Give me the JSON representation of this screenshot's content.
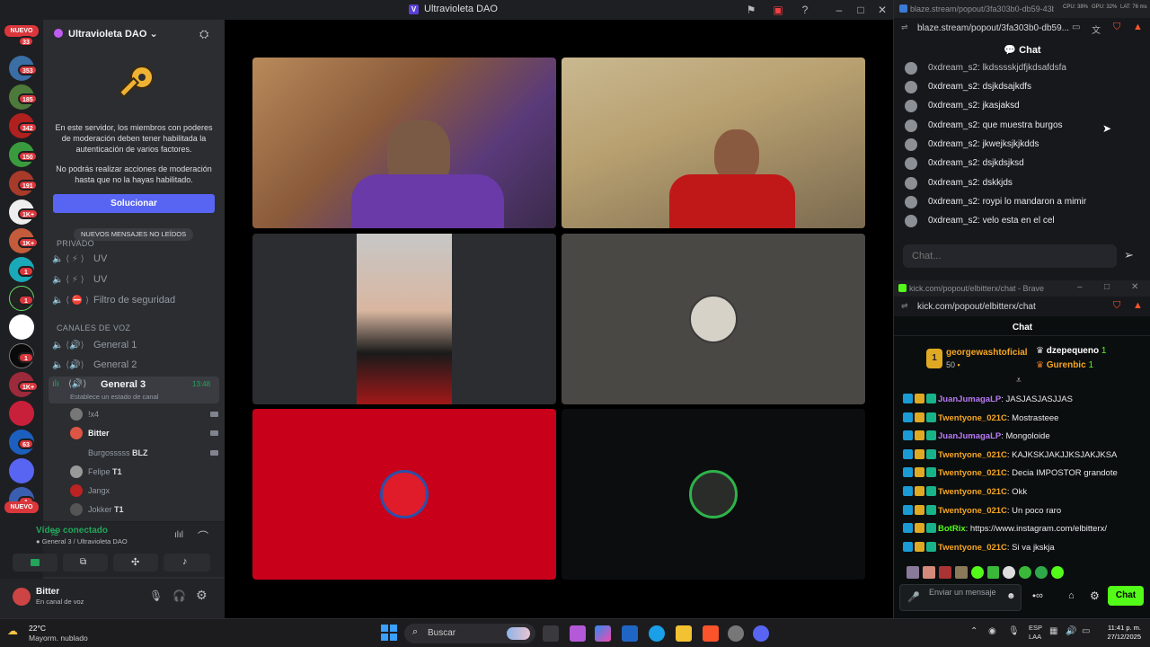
{
  "titlebar": {
    "app_letter": "V",
    "title": "Ultravioleta DAO"
  },
  "servers": {
    "top_badge": "NUEVO",
    "bottom_badge": "NUEVO",
    "badges": [
      "33",
      "353",
      "185",
      "342",
      "150",
      "191",
      "1K+",
      "1K+",
      "1",
      "1",
      "1",
      "1K+",
      "63",
      "1",
      "1"
    ]
  },
  "sidebar": {
    "server_name": "Ultravioleta DAO",
    "chevron": "⌄",
    "mfa_notice_1": "En este servidor, los miembros con poderes de moderación deben tener habilitada la autenticación de varios factores.",
    "mfa_notice_2": "No podrás realizar acciones de moderación hasta que no la hayas habilitado.",
    "solve_button": "Solucionar",
    "new_messages_pill": "NUEVOS MENSAJES NO LEÍDOS",
    "private_category": "PRIVADO",
    "private_channels": [
      "UV",
      "UV",
      "Filtro de seguridad"
    ],
    "voice_category": "CANALES DE VOZ",
    "voice_channels": [
      "General 1",
      "General 2",
      "General 3"
    ],
    "active_time": "13:48",
    "status_hint": "Establece un estado de canal",
    "members": [
      {
        "name": "!x4",
        "tag": ""
      },
      {
        "name": "Bitter",
        "tag": ""
      },
      {
        "name": "Burgosssss",
        "tag": "BLZ"
      },
      {
        "name": "Felipe",
        "tag": "T1"
      },
      {
        "name": "Jangx",
        "tag": ""
      },
      {
        "name": "Jokker",
        "tag": "T1"
      }
    ]
  },
  "voice_panel": {
    "status": "Vídeo conectado",
    "location": "General 3 / Ultravioleta DAO"
  },
  "user_panel": {
    "name": "Bitter",
    "status": "En canal de voz"
  },
  "blaze": {
    "tab_url": "blaze.stream/popout/3fa303b0-db59-43b...",
    "address": "blaze.stream/popout/3fa303b0-db59...",
    "header": "Chat",
    "messages": [
      "0xdream_s2: lkdsssskjdfjkdsafdsfa",
      "0xdream_s2: dsjkdsajkdfs",
      "0xdream_s2: jkasjaksd",
      "0xdream_s2: que muestra burgos",
      "0xdream_s2: jkwejksjkjkdds",
      "0xdream_s2: dsjkdsjksd",
      "0xdream_s2: dskkjds",
      "0xdream_s2: roypi lo mandaron a mimir",
      "0xdream_s2: velo esta en el cel"
    ],
    "input_placeholder": "Chat...",
    "sys_cpu": "CPU: 38%",
    "sys_gpu": "GPU: 32%",
    "sys_lat": "LAT: 76 ms"
  },
  "kick": {
    "tab_url": "kick.com/popout/elbitterx/chat - Brave",
    "address": "kick.com/popout/elbitterx/chat",
    "header": "Chat",
    "gifter_rank": "1",
    "gifter_name": "georgewashtoficial",
    "gifter_amount": "50",
    "top_user_1": "dzepequeno",
    "top_user_1_count": "1",
    "top_user_2": "Gurenbic",
    "top_user_2_count": "1",
    "messages": [
      {
        "user": "JuanJumagaLP",
        "color": "#b97af5",
        "text": ": JASJASJASJJAS"
      },
      {
        "user": "Twentyone_021C",
        "color": "#f5a623",
        "text": ": Mostrasteee"
      },
      {
        "user": "JuanJumagaLP",
        "color": "#b97af5",
        "text": ": Mongoloide"
      },
      {
        "user": "Twentyone_021C",
        "color": "#f5a623",
        "text": ": KAJKSKJAKJJKSJAKJKSA"
      },
      {
        "user": "Twentyone_021C",
        "color": "#f5a623",
        "text": ": Decia IMPOSTOR grandote"
      },
      {
        "user": "Twentyone_021C",
        "color": "#f5a623",
        "text": ": Okk"
      },
      {
        "user": "Twentyone_021C",
        "color": "#f5a623",
        "text": ": Un poco raro"
      },
      {
        "user": "BotRix",
        "color": "#53fc18",
        "text": ": https://www.instagram.com/elbitterx/"
      },
      {
        "user": "Twentyone_021C",
        "color": "#f5a623",
        "text": ": Si va jkskja"
      }
    ],
    "input_placeholder": "Enviar un mensaje",
    "chat_button": "Chat",
    "brand_color": "#53fc18"
  },
  "taskbar": {
    "weather_temp": "22°C",
    "weather_desc": "Mayorm. nublado",
    "search": "Buscar",
    "lang_1": "ESP",
    "lang_2": "LAA",
    "time": "11:41 p. m.",
    "date": "27/12/2025"
  }
}
